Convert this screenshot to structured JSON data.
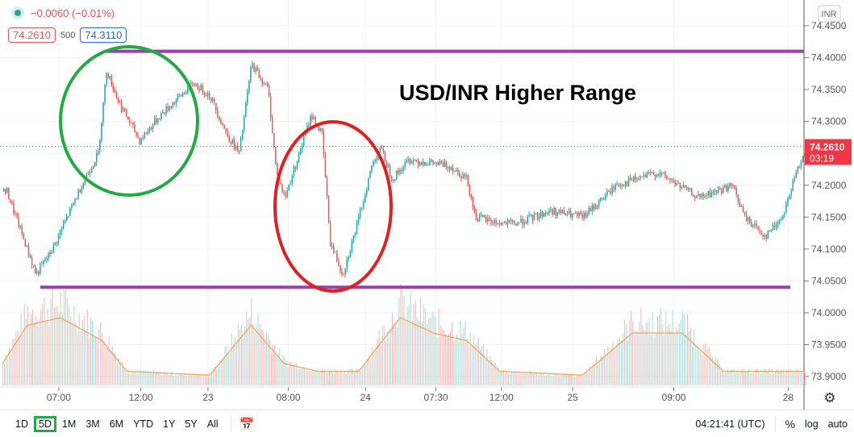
{
  "legend": {
    "change": "−0.0060 (−0.01%)",
    "bid": "74.2610",
    "spread": "500",
    "ask": "74.3110"
  },
  "currency": "INR",
  "current_price": {
    "value": "74.2610",
    "countdown": "03:19"
  },
  "bottom": {
    "ranges": [
      "1D",
      "5D",
      "1M",
      "3M",
      "6M",
      "YTD",
      "1Y",
      "5Y",
      "All"
    ],
    "active": "5D",
    "clock": "04:21:41 (UTC)",
    "pct": "%",
    "log": "log",
    "auto": "auto"
  },
  "colors": {
    "up": "#26a69a",
    "down": "#ef5350",
    "annotation_line": "#9c3fa8",
    "green_circle": "#22aa44",
    "red_circle": "#e02020",
    "price_label": "#f23645"
  },
  "chart_data": {
    "type": "candlestick",
    "title": "USD/INR Higher Range",
    "ylim": [
      73.88,
      74.46
    ],
    "yticks": [
      "74.4500",
      "74.4000",
      "74.3500",
      "74.3000",
      "74.2500",
      "74.2000",
      "74.1500",
      "74.1000",
      "74.0500",
      "74.0000",
      "73.9500",
      "73.9000"
    ],
    "xticks": [
      "07:00",
      "12:00",
      "23",
      "08:00",
      "24",
      "07:30",
      "12:00",
      "25",
      "09:00",
      "28"
    ],
    "xtick_index": [
      68,
      167,
      248,
      345,
      438,
      523,
      602,
      688,
      810,
      948
    ],
    "bars": 970,
    "price_path": [
      [
        5,
        74.19
      ],
      [
        40,
        74.06
      ],
      [
        60,
        74.1
      ],
      [
        95,
        74.2
      ],
      [
        115,
        74.25
      ],
      [
        125,
        74.38
      ],
      [
        140,
        74.33
      ],
      [
        165,
        74.27
      ],
      [
        190,
        74.31
      ],
      [
        230,
        74.36
      ],
      [
        250,
        74.34
      ],
      [
        270,
        74.28
      ],
      [
        285,
        74.25
      ],
      [
        300,
        74.39
      ],
      [
        320,
        74.35
      ],
      [
        330,
        74.22
      ],
      [
        340,
        74.18
      ],
      [
        360,
        74.26
      ],
      [
        372,
        74.31
      ],
      [
        385,
        74.28
      ],
      [
        395,
        74.11
      ],
      [
        410,
        74.06
      ],
      [
        430,
        74.15
      ],
      [
        445,
        74.23
      ],
      [
        455,
        74.26
      ],
      [
        470,
        74.21
      ],
      [
        490,
        74.24
      ],
      [
        540,
        74.23
      ],
      [
        560,
        74.21
      ],
      [
        570,
        74.15
      ],
      [
        600,
        74.14
      ],
      [
        620,
        74.14
      ],
      [
        660,
        74.16
      ],
      [
        700,
        74.15
      ],
      [
        740,
        74.2
      ],
      [
        790,
        74.22
      ],
      [
        840,
        74.18
      ],
      [
        880,
        74.2
      ],
      [
        895,
        74.15
      ],
      [
        920,
        74.12
      ],
      [
        940,
        74.15
      ],
      [
        955,
        74.21
      ],
      [
        968,
        74.26
      ]
    ],
    "volume_activity": [
      [
        0,
        0.2
      ],
      [
        30,
        0.7
      ],
      [
        70,
        0.8
      ],
      [
        120,
        0.5
      ],
      [
        150,
        0.1
      ],
      [
        250,
        0.05
      ],
      [
        300,
        0.7
      ],
      [
        340,
        0.2
      ],
      [
        380,
        0.1
      ],
      [
        430,
        0.1
      ],
      [
        480,
        0.8
      ],
      [
        520,
        0.6
      ],
      [
        560,
        0.5
      ],
      [
        600,
        0.1
      ],
      [
        700,
        0.05
      ],
      [
        760,
        0.6
      ],
      [
        820,
        0.6
      ],
      [
        870,
        0.1
      ],
      [
        970,
        0.1
      ]
    ],
    "annotations": {
      "resistance": 74.41,
      "support": 74.04,
      "text": "USD/INR Higher Range"
    }
  }
}
